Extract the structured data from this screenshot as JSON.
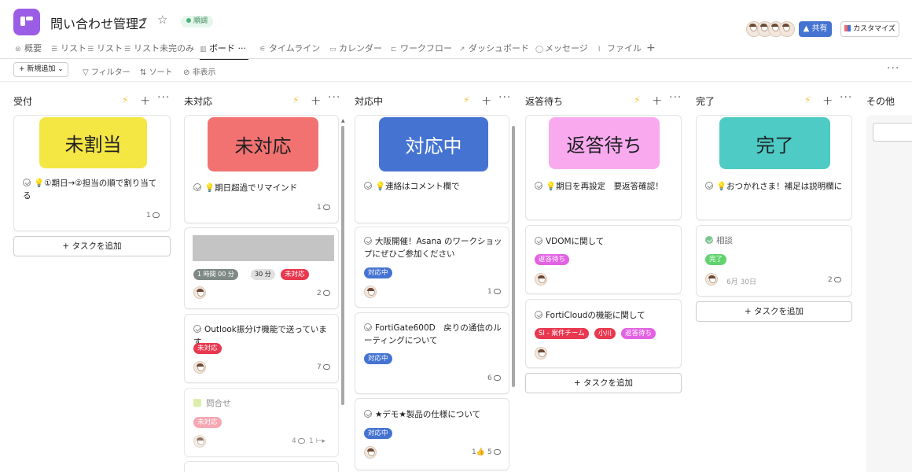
{
  "header": {
    "title": "問い合わせ管理2",
    "status": "順調",
    "share_label": "共有",
    "customize_label": "カスタマイズ"
  },
  "tabs": [
    {
      "label": "概要"
    },
    {
      "label": "リスト"
    },
    {
      "label": "リスト"
    },
    {
      "label": "リスト未完のみ"
    },
    {
      "label": "ボード"
    },
    {
      "label": "タイムライン"
    },
    {
      "label": "カレンダー"
    },
    {
      "label": "ワークフロー"
    },
    {
      "label": "ダッシュボード"
    },
    {
      "label": "メッセージ"
    },
    {
      "label": "ファイル"
    }
  ],
  "toolbar": {
    "new_label": "新規追加",
    "filter_label": "フィルター",
    "sort_label": "ソート",
    "hide_label": "非表示"
  },
  "columns": {
    "c0": {
      "title": "受付",
      "cover": "未割当",
      "card1": {
        "title": "💡①期日→②担当の順で割り当てる",
        "count": "1"
      },
      "add_task": "+ タスクを追加"
    },
    "c1": {
      "title": "未対応",
      "cover": "未対応",
      "card1": {
        "title": "💡期日超過でリマインド",
        "count": "1"
      },
      "card2": {
        "time1": "1 時間 00 分",
        "time2": "30 分",
        "tag": "未対応",
        "count": "2"
      },
      "card3": {
        "title": "Outlook振分け機能で送っています",
        "tag": "未対応",
        "count": "7"
      },
      "card4": {
        "title": "問合せ",
        "tag": "未対応",
        "count": "4",
        "sub": "1"
      }
    },
    "c2": {
      "title": "対応中",
      "cover": "対応中",
      "card1": {
        "title": "💡連絡はコメント欄で"
      },
      "card2": {
        "title": "大阪開催！Asana のワークショップにぜひご参加ください",
        "tag": "対応中",
        "count": "1"
      },
      "card3": {
        "title": "FortiGate600D　戻りの通信のルーティングについて",
        "tag": "対応中",
        "count": "6"
      },
      "card4": {
        "title": "★デモ★製品の仕様について",
        "tag": "対応中",
        "likes": "1",
        "count": "5"
      }
    },
    "c3": {
      "title": "返答待ち",
      "cover": "返答待ち",
      "card1": {
        "title": "💡期日を再設定　要返答確認！"
      },
      "card2": {
        "title": "VDOMに関して",
        "tag": "返答待ち"
      },
      "card3": {
        "title": "FortiCloudの機能に関して",
        "tag1": "SI - 案件チーム",
        "tag2": "小川",
        "tag3": "返答待ち"
      },
      "add_task": "+ タスクを追加"
    },
    "c4": {
      "title": "完了",
      "cover": "完了",
      "card1": {
        "title": "💡おつかれさま！補足は説明欄に"
      },
      "card2": {
        "title": "相談",
        "tag": "完了",
        "date": "6月 30日",
        "count": "2"
      },
      "add_task": "+ タスクを追加"
    },
    "c5": {
      "title": "その他"
    }
  },
  "colors": {
    "cover_yellow": "#f4e643",
    "cover_red": "#f27272",
    "cover_blue": "#4573d2",
    "cover_pink": "#f9aaef",
    "cover_teal": "#4ecbc4",
    "tag_red": "#e8384f",
    "tag_blue": "#4573d2",
    "tag_purple": "#e362e3",
    "tag_green": "#62d26f"
  }
}
